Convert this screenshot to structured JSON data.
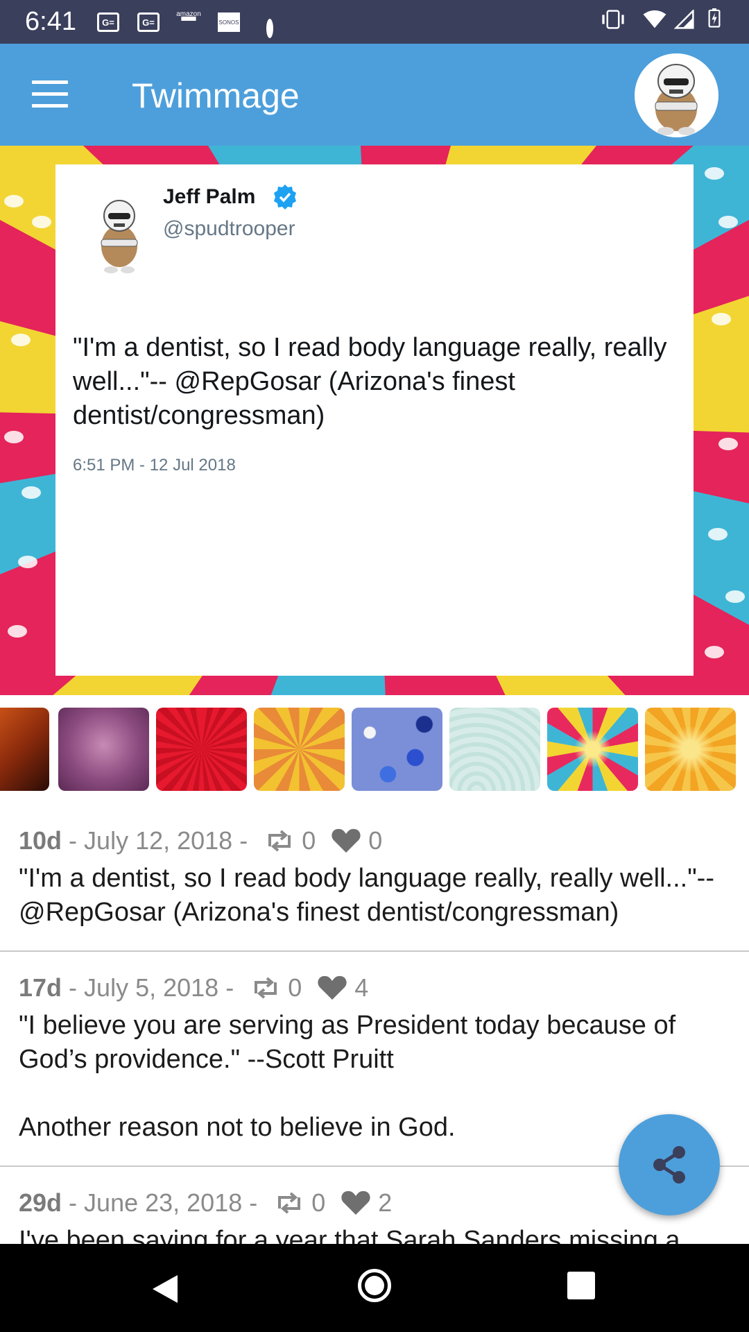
{
  "status_bar": {
    "time": "6:41",
    "left_icons": [
      "gmail-icon",
      "gmail-icon",
      "amazon-icon",
      "sonos-icon",
      "dot-icon"
    ],
    "amazon_label": "amazon",
    "sonos_label": "SONOS",
    "right_icons": [
      "vibrate-icon",
      "wifi-icon",
      "signal-icon",
      "battery-icon"
    ]
  },
  "app_bar": {
    "title": "Twimmage"
  },
  "tweet_card": {
    "name": "Jeff Palm",
    "handle": "@spudtrooper",
    "text": "\"I'm a dentist, so I read body language really, really well...\"-- @RepGosar (Arizona's finest dentist/congressman)",
    "time": "6:51 PM - 12 Jul 2018",
    "verified": true
  },
  "backgrounds": [
    {
      "name": "dark-orange-gradient"
    },
    {
      "name": "purple-grunge"
    },
    {
      "name": "red-sunburst"
    },
    {
      "name": "yellow-orange-sunburst"
    },
    {
      "name": "blue-confetti"
    },
    {
      "name": "mint-swirls"
    },
    {
      "name": "pink-yellow-starburst"
    },
    {
      "name": "orange-yellow-dots-burst"
    }
  ],
  "feed": [
    {
      "ago": "10d",
      "date": "July 12, 2018",
      "retweets": "0",
      "likes": "0",
      "text": "\"I'm a dentist, so I read body language really, really well...\"--\n@RepGosar (Arizona's finest dentist/congressman)"
    },
    {
      "ago": "17d",
      "date": "July 5, 2018",
      "retweets": "0",
      "likes": "4",
      "text": "\"I believe you are serving as President today because of\nGod’s providence.\" --Scott Pruitt\n\nAnother reason not to believe in God."
    },
    {
      "ago": "29d",
      "date": "June 23, 2018",
      "retweets": "0",
      "likes": "2",
      "text": "I've been saying for a year that Sarah Sanders missing a meal"
    }
  ],
  "colors": {
    "status_bar": "#3a3f5c",
    "app_bar": "#4d9fdb",
    "fab": "#4d9fdb"
  }
}
